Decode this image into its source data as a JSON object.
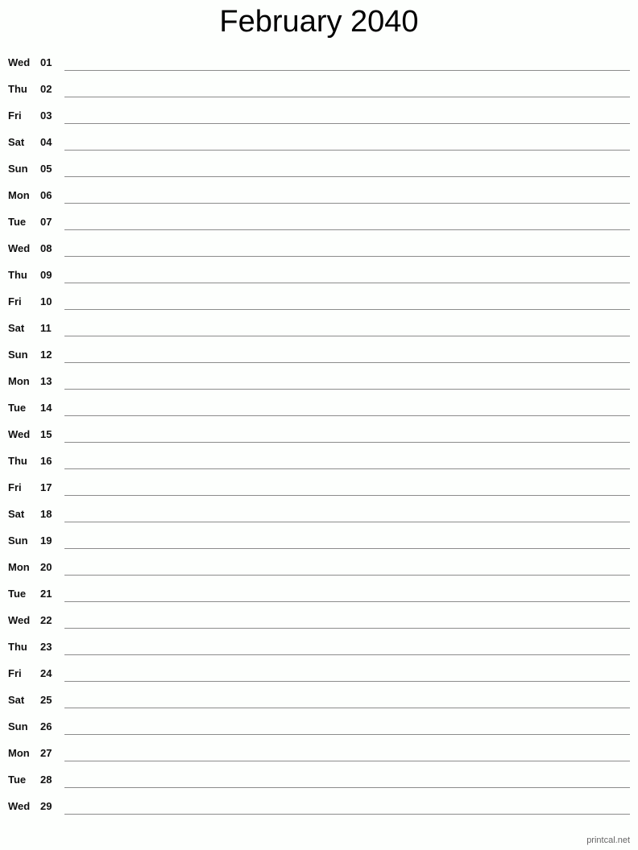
{
  "title": "February 2040",
  "days": [
    {
      "dow": "Wed",
      "day": "01"
    },
    {
      "dow": "Thu",
      "day": "02"
    },
    {
      "dow": "Fri",
      "day": "03"
    },
    {
      "dow": "Sat",
      "day": "04"
    },
    {
      "dow": "Sun",
      "day": "05"
    },
    {
      "dow": "Mon",
      "day": "06"
    },
    {
      "dow": "Tue",
      "day": "07"
    },
    {
      "dow": "Wed",
      "day": "08"
    },
    {
      "dow": "Thu",
      "day": "09"
    },
    {
      "dow": "Fri",
      "day": "10"
    },
    {
      "dow": "Sat",
      "day": "11"
    },
    {
      "dow": "Sun",
      "day": "12"
    },
    {
      "dow": "Mon",
      "day": "13"
    },
    {
      "dow": "Tue",
      "day": "14"
    },
    {
      "dow": "Wed",
      "day": "15"
    },
    {
      "dow": "Thu",
      "day": "16"
    },
    {
      "dow": "Fri",
      "day": "17"
    },
    {
      "dow": "Sat",
      "day": "18"
    },
    {
      "dow": "Sun",
      "day": "19"
    },
    {
      "dow": "Mon",
      "day": "20"
    },
    {
      "dow": "Tue",
      "day": "21"
    },
    {
      "dow": "Wed",
      "day": "22"
    },
    {
      "dow": "Thu",
      "day": "23"
    },
    {
      "dow": "Fri",
      "day": "24"
    },
    {
      "dow": "Sat",
      "day": "25"
    },
    {
      "dow": "Sun",
      "day": "26"
    },
    {
      "dow": "Mon",
      "day": "27"
    },
    {
      "dow": "Tue",
      "day": "28"
    },
    {
      "dow": "Wed",
      "day": "29"
    }
  ],
  "footer": "printcal.net"
}
